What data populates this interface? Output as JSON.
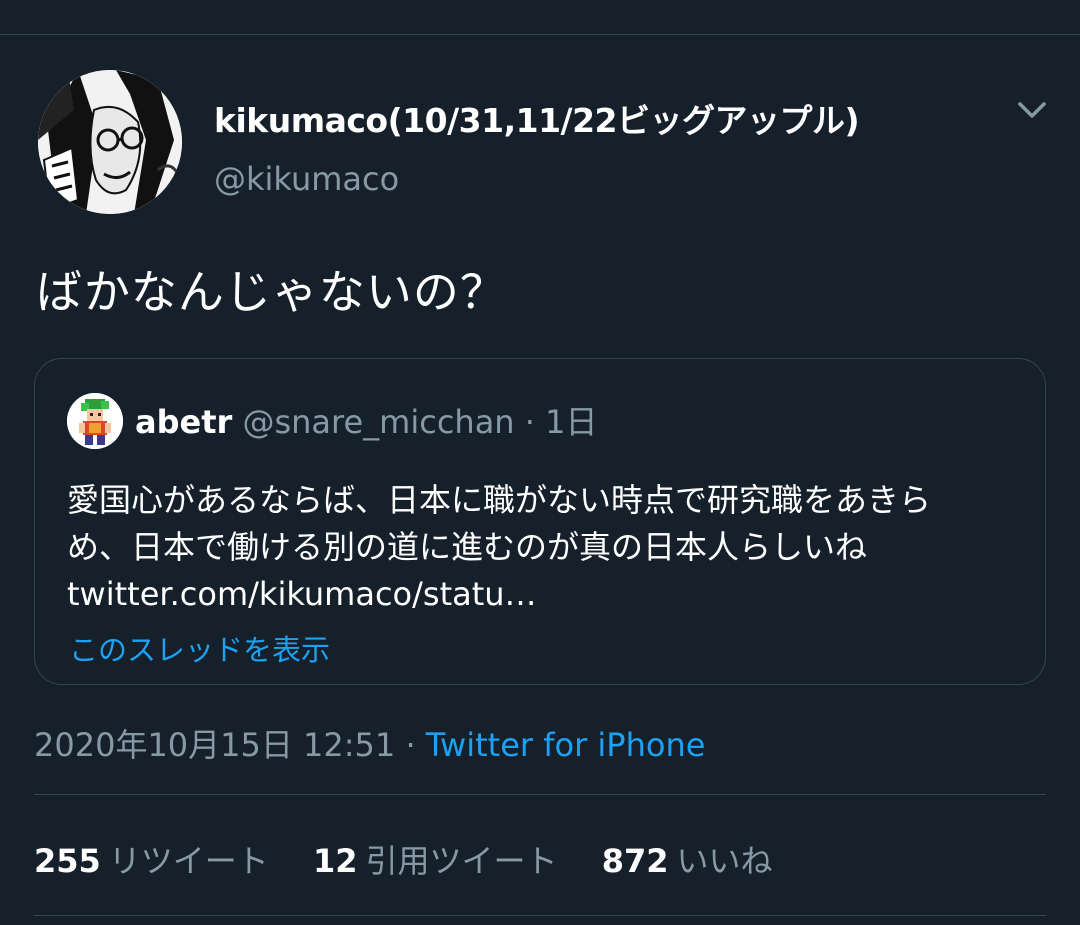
{
  "colors": {
    "background": "#15202b",
    "divider": "#38444d",
    "secondary_text": "#8899a6",
    "link": "#1da1f2",
    "primary_text": "#ffffff"
  },
  "tweet": {
    "display_name": "kikumaco(10/31,11/22ビッグアップル)",
    "handle": "@kikumaco",
    "avatar_icon": "manga-avatar-icon",
    "menu_icon": "chevron-down-icon",
    "text": "ばかなんじゃないの？",
    "quote": {
      "name": "abetr",
      "handle": "@snare_micchan",
      "separator": "·",
      "time": "1日",
      "avatar_icon": "pixel-character-avatar-icon",
      "lines": [
        "愛国心があるならば、日本に職がない時点で研究職をあきら",
        "め、日本で働ける別の道に進むのが真の日本人らしいね",
        "twitter.com/kikumaco/statu…"
      ],
      "thread_link": "このスレッドを表示"
    },
    "timestamp": "2020年10月15日 12:51",
    "meta_separator": "·",
    "source": "Twitter for iPhone",
    "stats": {
      "retweets": {
        "count": "255",
        "label": "リツイート"
      },
      "quotes": {
        "count": "12",
        "label": "引用ツイート"
      },
      "likes": {
        "count": "872",
        "label": "いいね"
      }
    }
  }
}
